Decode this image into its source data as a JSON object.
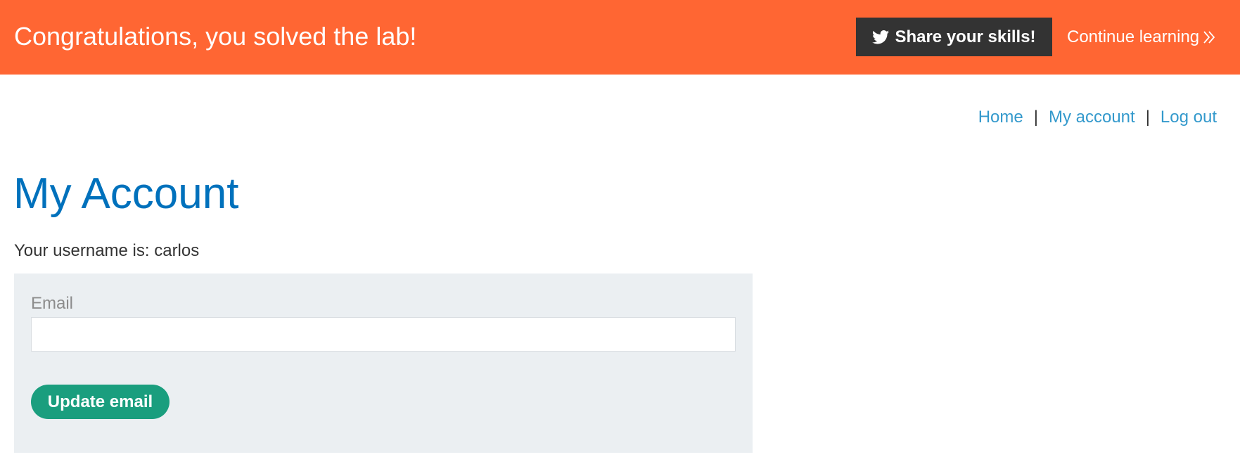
{
  "banner": {
    "title": "Congratulations, you solved the lab!",
    "share_label": "Share your skills!",
    "continue_label": "Continue learning",
    "background_color": "#ff6633",
    "share_icon": "twitter-icon",
    "continue_icon": "double-chevron-right-icon"
  },
  "nav": {
    "home": "Home",
    "my_account": "My account",
    "log_out": "Log out",
    "separator": "|"
  },
  "main": {
    "title": "My Account",
    "username_text": "Your username is: carlos",
    "form": {
      "email_label": "Email",
      "email_value": "",
      "update_label": "Update email"
    }
  },
  "colors": {
    "link": "#3399cc",
    "heading": "#0071bc",
    "button": "#1a9e7e",
    "form_bg": "#ebeff2"
  }
}
